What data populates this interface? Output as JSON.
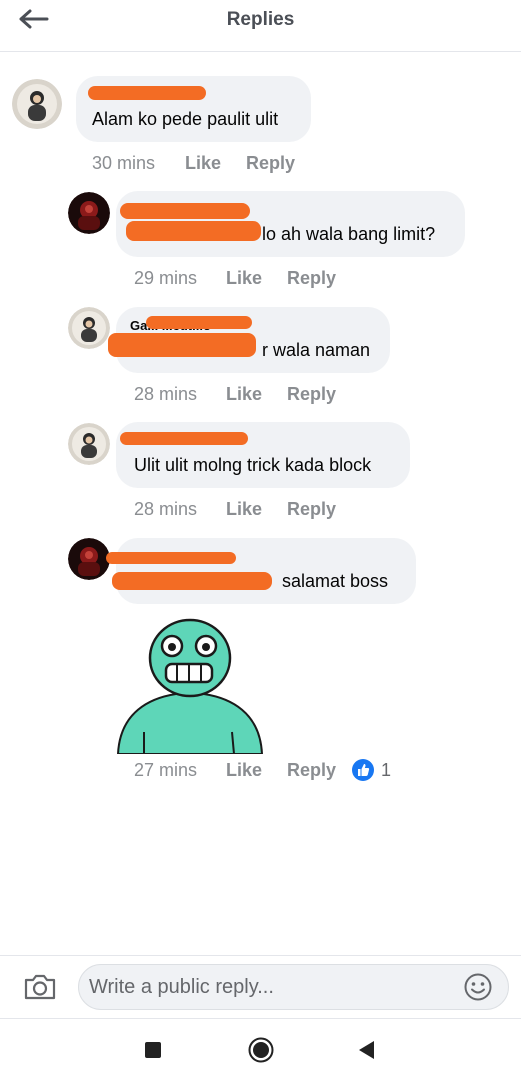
{
  "header": {
    "title": "Replies"
  },
  "comments": [
    {
      "name": "",
      "text": "Alam ko pede paulit ulit",
      "time": "30 mins",
      "like": "Like",
      "reply": "Reply"
    },
    {
      "name": "",
      "text": "lo ah wala bang limit?",
      "time": "29 mins",
      "like": "Like",
      "reply": "Reply"
    },
    {
      "name": "Ga... ...cutillo",
      "text": "r wala naman",
      "time": "28 mins",
      "like": "Like",
      "reply": "Reply"
    },
    {
      "name": "",
      "text": "Ulit ulit molng trick kada block",
      "time": "28 mins",
      "like": "Like",
      "reply": "Reply"
    },
    {
      "name": "",
      "text": "salamat boss",
      "time": "27 mins",
      "like": "Like",
      "reply": "Reply",
      "reaction_count": "1"
    }
  ],
  "composer": {
    "placeholder": "Write a public reply..."
  },
  "colors": {
    "bubble": "#f0f2f5",
    "redaction": "#f36c24",
    "like_blue": "#1877f2",
    "meta_gray": "#8a8d91",
    "sticker_teal": "#5ed6b8"
  },
  "icons": [
    "back-arrow-icon",
    "camera-icon",
    "emoji-icon",
    "like-thumb-icon",
    "nav-recents-icon",
    "nav-home-icon",
    "nav-back-icon"
  ]
}
